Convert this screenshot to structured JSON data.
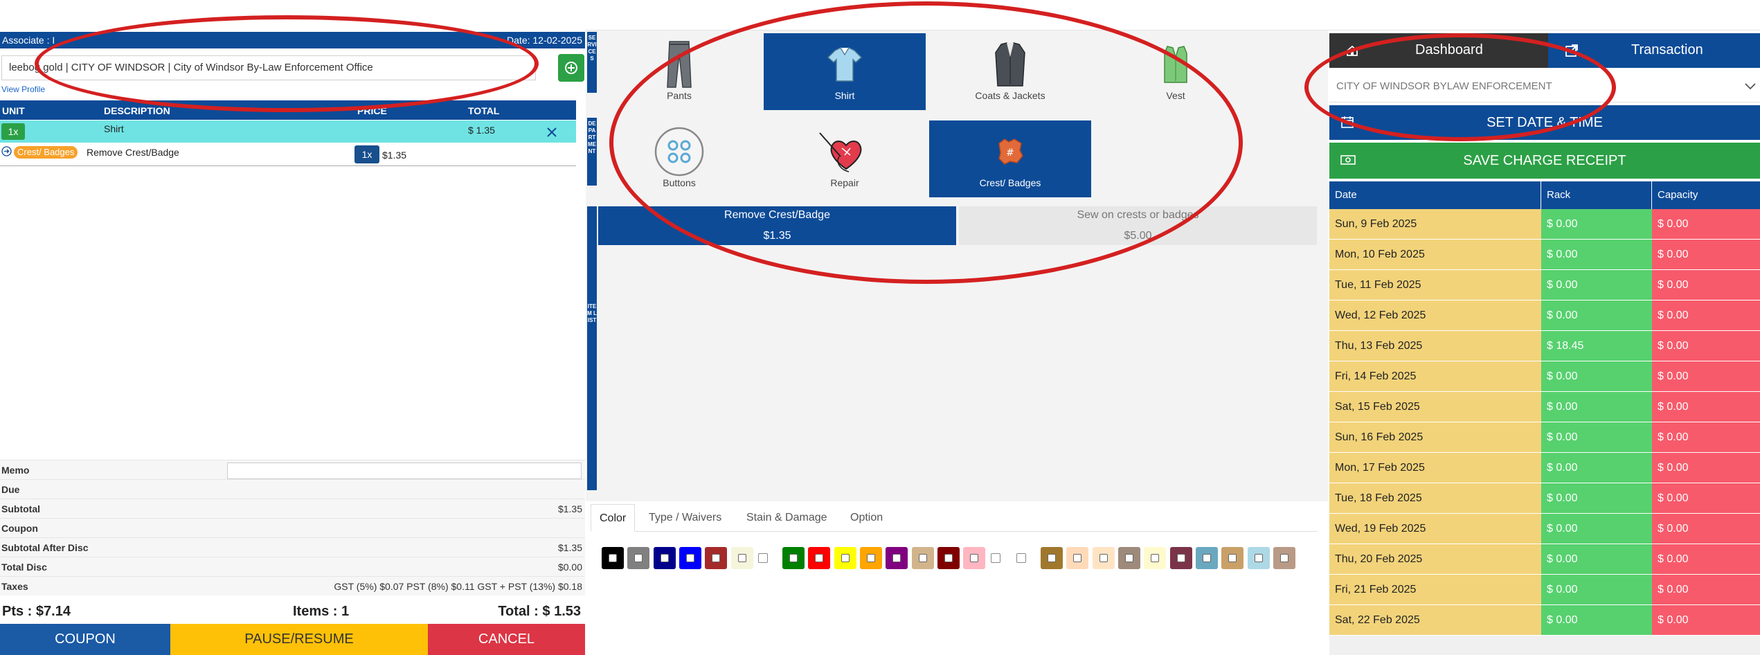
{
  "header": {
    "associate": "Associate : I",
    "date": "Date: 12-02-2025"
  },
  "customer": {
    "value": "leebog gold | CITY OF WINDSOR | City of Windsor By-Law Enforcement Office",
    "view_profile": "View Profile"
  },
  "line_items": {
    "headers": [
      "UNIT",
      "DESCRIPTION",
      "PRICE",
      "TOTAL"
    ],
    "row": {
      "qty": "1x",
      "description": "Shirt",
      "total": "$ 1.35"
    },
    "sub": {
      "badge": "Crest/ Badges",
      "description": "Remove Crest/Badge",
      "qty": "1x",
      "price": "$1.35"
    }
  },
  "totals": {
    "memo_label": "Memo",
    "rows": [
      {
        "label": "Due",
        "value": ""
      },
      {
        "label": "Subtotal",
        "value": "$1.35"
      },
      {
        "label": "Coupon",
        "value": ""
      },
      {
        "label": "Subtotal After Disc",
        "value": "$1.35"
      },
      {
        "label": "Total Disc",
        "value": "$0.00"
      },
      {
        "label": "Taxes",
        "value": "GST (5%) $0.07 PST (8%) $0.11 GST + PST (13%) $0.18"
      }
    ],
    "pts": "Pts : $7.14",
    "items": "Items : 1",
    "total": "Total : $ 1.53"
  },
  "buttons": {
    "coupon": "COUPON",
    "pause": "PAUSE/RESUME",
    "cancel": "CANCEL"
  },
  "side_tabs": {
    "services": "SERVICES",
    "department": "DEPARTMENT",
    "item_list": "ITEM LIST"
  },
  "departments": [
    {
      "label": "Pants",
      "icon": "pants-icon"
    },
    {
      "label": "Shirt",
      "icon": "shirt-icon"
    },
    {
      "label": "Coats & Jackets",
      "icon": "coat-icon"
    },
    {
      "label": "Vest",
      "icon": "vest-icon"
    },
    {
      "label": "Buttons",
      "icon": "buttons-icon"
    },
    {
      "label": "Repair",
      "icon": "repair-heart-icon"
    },
    {
      "label": "Crest/ Badges",
      "icon": "crest-icon"
    }
  ],
  "items": [
    {
      "name": "Remove Crest/Badge",
      "price": "$1.35"
    },
    {
      "name": "Sew on crests or badges",
      "price": "$5.00"
    }
  ],
  "option_tabs": [
    "Color",
    "Type / Waivers",
    "Stain & Damage",
    "Option"
  ],
  "colors": [
    "#000000",
    "#808080",
    "#00008b",
    "#0000ff",
    "#a52a2a",
    "#f5f5dc",
    "",
    "#008000",
    "#ff0000",
    "#ffff00",
    "#ffa500",
    "#800080",
    "#d2b48c",
    "#800000",
    "#ffb6c1",
    "",
    "",
    "#a0782d",
    "#ffdab9",
    "#ffe4c4",
    "#9e8a7a",
    "#fffacd",
    "#7b3348",
    "#6aa8c0",
    "#c9a068",
    "#add8e6",
    "#b89a86"
  ],
  "right": {
    "dashboard": "Dashboard",
    "transaction": "Transaction",
    "department": "CITY OF WINDSOR BYLAW ENFORCEMENT",
    "set_date": "SET DATE & TIME",
    "save_receipt": "SAVE CHARGE RECEIPT",
    "capacity_headers": [
      "Date",
      "Rack",
      "Capacity"
    ],
    "capacity_rows": [
      {
        "date": "Sun, 9 Feb 2025",
        "rack": "$ 0.00",
        "capacity": "$ 0.00"
      },
      {
        "date": "Mon, 10 Feb 2025",
        "rack": "$ 0.00",
        "capacity": "$ 0.00"
      },
      {
        "date": "Tue, 11 Feb 2025",
        "rack": "$ 0.00",
        "capacity": "$ 0.00"
      },
      {
        "date": "Wed, 12 Feb 2025",
        "rack": "$ 0.00",
        "capacity": "$ 0.00"
      },
      {
        "date": "Thu, 13 Feb 2025",
        "rack": "$ 18.45",
        "capacity": "$ 0.00"
      },
      {
        "date": "Fri, 14 Feb 2025",
        "rack": "$ 0.00",
        "capacity": "$ 0.00"
      },
      {
        "date": "Sat, 15 Feb 2025",
        "rack": "$ 0.00",
        "capacity": "$ 0.00"
      },
      {
        "date": "Sun, 16 Feb 2025",
        "rack": "$ 0.00",
        "capacity": "$ 0.00"
      },
      {
        "date": "Mon, 17 Feb 2025",
        "rack": "$ 0.00",
        "capacity": "$ 0.00"
      },
      {
        "date": "Tue, 18 Feb 2025",
        "rack": "$ 0.00",
        "capacity": "$ 0.00"
      },
      {
        "date": "Wed, 19 Feb 2025",
        "rack": "$ 0.00",
        "capacity": "$ 0.00"
      },
      {
        "date": "Thu, 20 Feb 2025",
        "rack": "$ 0.00",
        "capacity": "$ 0.00"
      },
      {
        "date": "Fri, 21 Feb 2025",
        "rack": "$ 0.00",
        "capacity": "$ 0.00"
      },
      {
        "date": "Sat, 22 Feb 2025",
        "rack": "$ 0.00",
        "capacity": "$ 0.00"
      }
    ]
  },
  "theme": {
    "primary": "#0d4b97",
    "success": "#2ca046",
    "warning": "#ffc107",
    "danger": "#dc3545",
    "annotation": "#d42020"
  }
}
